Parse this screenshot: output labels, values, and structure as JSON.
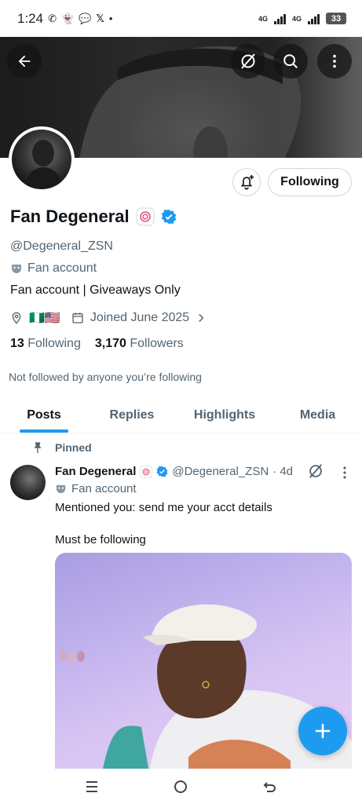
{
  "status_bar": {
    "time": "1:24",
    "notif_icons": [
      "whatsapp-icon",
      "snapchat-icon",
      "chat-icon",
      "x-icon"
    ],
    "network1": "4G",
    "network2": "4G",
    "battery": "33"
  },
  "profile": {
    "display_name": "Fan Degeneral",
    "handle": "@Degeneral_ZSN",
    "fan_label": "Fan account",
    "bio": "Fan account | Giveaways Only",
    "flags": "🇳🇬🇺🇸",
    "joined": "Joined June 2025",
    "following_count": "13",
    "following_label": "Following",
    "followers_count": "3,170",
    "followers_label": "Followers",
    "not_followed": "Not followed by anyone you’re following",
    "follow_button": "Following"
  },
  "tabs": [
    "Posts",
    "Replies",
    "Highlights",
    "Media"
  ],
  "post": {
    "pinned_label": "Pinned",
    "name": "Fan Degeneral",
    "handle": "@Degeneral_ZSN",
    "age": "· 4d",
    "fan_label": "Fan account",
    "text1": "Mentioned you: send me your acct details",
    "text2": "Must be following"
  },
  "colors": {
    "accent": "#1d9bf0",
    "text": "#0f1419",
    "muted": "#536471"
  }
}
